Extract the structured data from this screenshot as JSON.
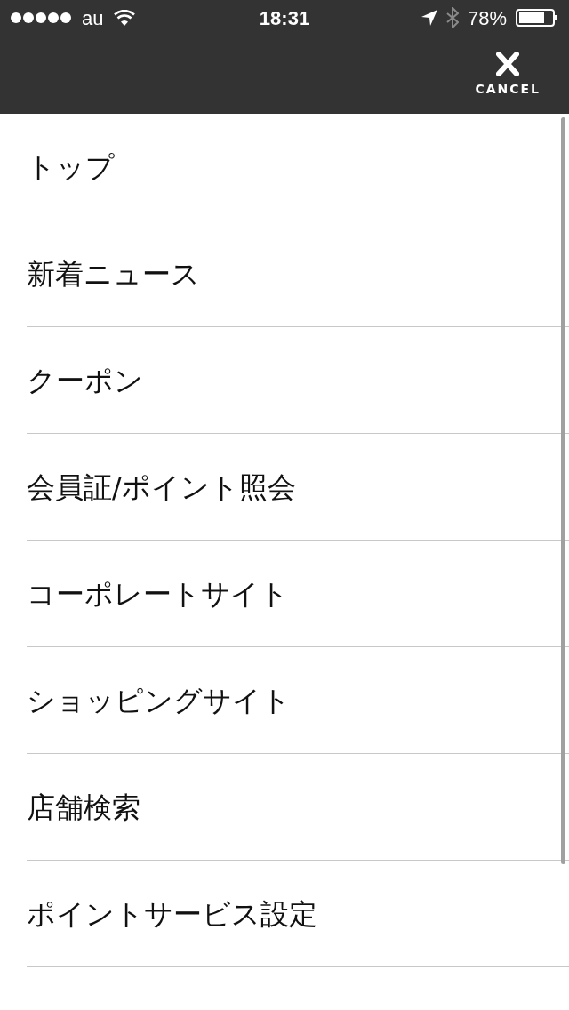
{
  "status_bar": {
    "carrier": "au",
    "time": "18:31",
    "battery": "78%"
  },
  "nav_bar": {
    "cancel_label": "CANCEL"
  },
  "menu": {
    "items": [
      {
        "label": "トップ"
      },
      {
        "label": "新着ニュース"
      },
      {
        "label": "クーポン"
      },
      {
        "label": "会員証/ポイント照会"
      },
      {
        "label": "コーポレートサイト"
      },
      {
        "label": "ショッピングサイト"
      },
      {
        "label": "店舗検索"
      },
      {
        "label": "ポイントサービス設定"
      }
    ]
  }
}
